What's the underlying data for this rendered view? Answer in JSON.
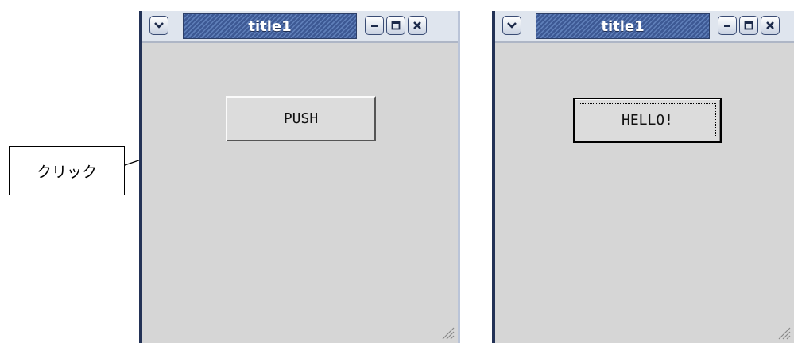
{
  "callout": {
    "label": "クリック"
  },
  "windows": [
    {
      "title": "title1",
      "button_label": "PUSH"
    },
    {
      "title": "title1",
      "button_label": "HELLO!"
    }
  ],
  "icons": {
    "menu": "chevron-down-icon",
    "minimize": "minimize-icon",
    "maximize": "maximize-icon",
    "close": "close-icon",
    "resize": "resize-grip-icon"
  }
}
